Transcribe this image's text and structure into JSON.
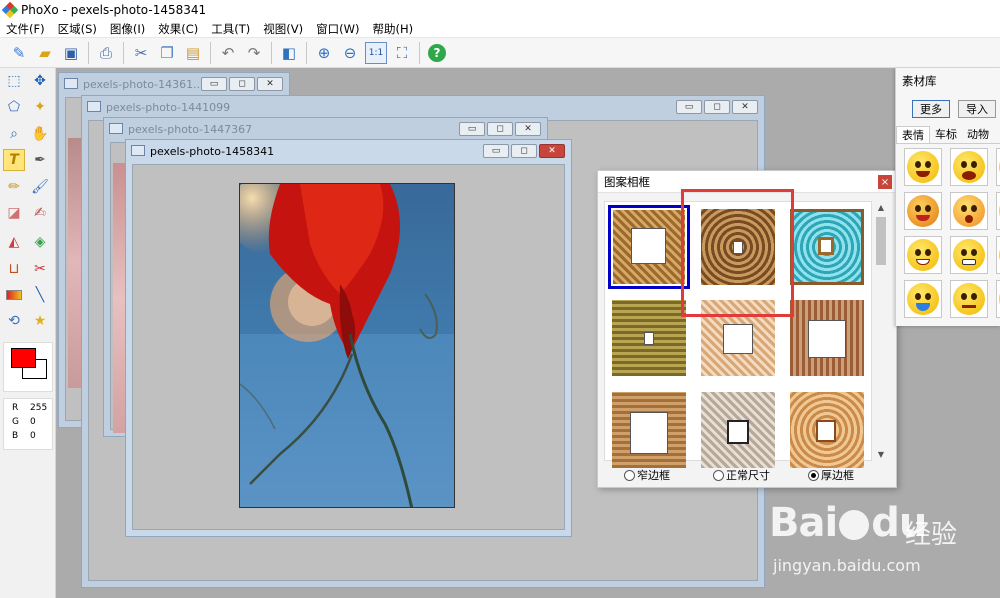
{
  "app": {
    "title": "PhoXo - pexels-photo-1458341"
  },
  "menu": [
    "文件(F)",
    "区域(S)",
    "图像(I)",
    "效果(C)",
    "工具(T)",
    "视图(V)",
    "窗口(W)",
    "帮助(H)"
  ],
  "colors": {
    "foreground": "#ff0000",
    "background": "#ffffff",
    "accent_select": "#0000c8",
    "highlight_box": "#e03a3a"
  },
  "rgb_readout": {
    "R_label": "R",
    "R": "255",
    "G_label": "G",
    "G": "0",
    "B_label": "B",
    "B": "0"
  },
  "windows": [
    {
      "title": "pexels-photo-14361..."
    },
    {
      "title": "pexels-photo-1441099"
    },
    {
      "title": "pexels-photo-1447367"
    },
    {
      "title": "pexels-photo-1458341"
    }
  ],
  "frames_panel": {
    "title": "图案相框",
    "close": "×",
    "options": [
      {
        "label": "窄边框",
        "checked": false
      },
      {
        "label": "正常尺寸",
        "checked": false
      },
      {
        "label": "厚边框",
        "checked": true
      }
    ]
  },
  "library": {
    "title": "素材库",
    "more_button": "更多",
    "import_button": "导入",
    "tabs": [
      "表情",
      "车标",
      "动物"
    ]
  },
  "watermark": {
    "brand": "Bai",
    "brand2": "du",
    "sub": "经验",
    "url": "jingyan.baidu.com"
  }
}
